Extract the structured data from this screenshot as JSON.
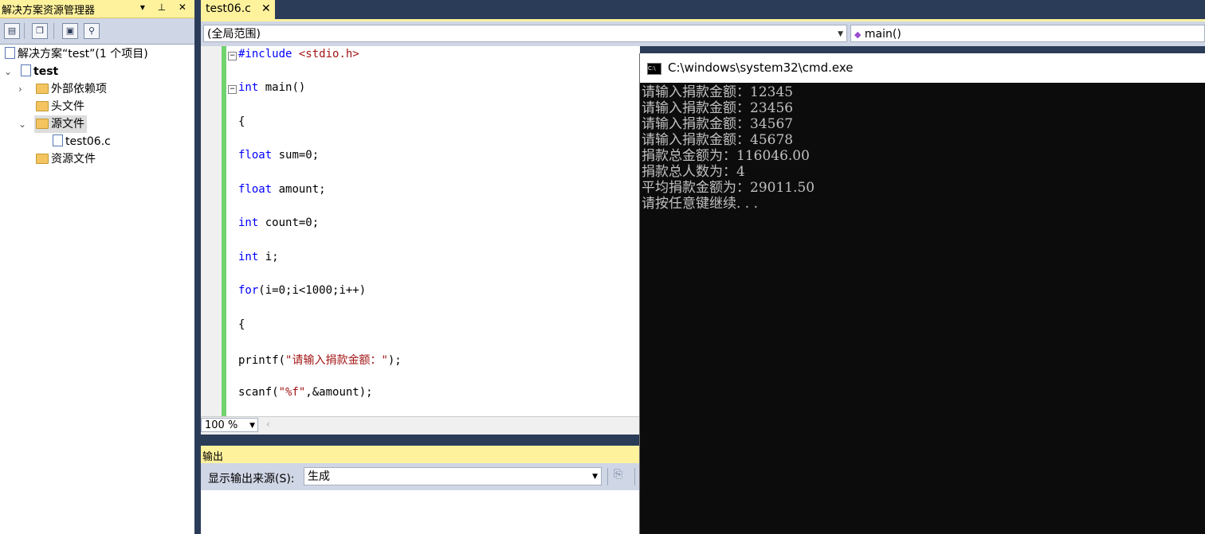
{
  "solution_explorer": {
    "title": "解决方案资源管理器",
    "title_buttons": "▾ ⊥ ✕",
    "toolbar_icons": [
      "properties-icon",
      "show-all-files-icon",
      "refresh-icon",
      "class-view-icon"
    ],
    "solution_label": "解决方案“test”(1 个项目)",
    "project_label": "test",
    "items": [
      {
        "label": "外部依赖项",
        "icon": "external-deps-icon"
      },
      {
        "label": "头文件",
        "icon": "folder-icon"
      },
      {
        "label": "源文件",
        "icon": "folder-open-icon"
      },
      {
        "label": "test06.c",
        "icon": "c-file-icon"
      },
      {
        "label": "资源文件",
        "icon": "folder-icon"
      }
    ]
  },
  "editor": {
    "tab_label": "test06.c",
    "tab_close": "✕",
    "scope_dropdown": "(全局范围)",
    "member_dropdown": "main()",
    "zoom": "100 %",
    "code": {
      "l1_kw": "#include",
      "l1_rest": " <stdio.h>",
      "l2_kw": "int",
      "l2_rest": " main()",
      "l3": "{",
      "l4_kw": "float",
      "l4_rest": " sum=0;",
      "l5_kw": "float",
      "l5_rest": " amount;",
      "l6_kw": "int",
      "l6_rest": " count=0;",
      "l7_kw": "int",
      "l7_rest": " i;",
      "l8_kw": "for",
      "l8_rest": "(i=0;i<1000;i++)",
      "l9": "{",
      "l10_a": "printf(",
      "l10_str": "\"请输入捐款金额：\"",
      "l10_b": ");",
      "l11_a": "scanf(",
      "l11_str": "\"%f\"",
      "l11_b": ",&amount);"
    }
  },
  "output": {
    "title": "输出",
    "source_label": "显示输出来源(S):",
    "source_value": "生成"
  },
  "cmd": {
    "title": "C:\\windows\\system32\\cmd.exe",
    "icon_text": "C:\\",
    "lines": [
      "请输入捐款金额：12345",
      "请输入捐款金额：23456",
      "请输入捐款金额：34567",
      "请输入捐款金额：45678",
      "捐款总金额为：116046.00",
      "捐款总人数为：4",
      "平均捐款金额为：29011.50",
      "请按任意键继续. . ."
    ]
  }
}
